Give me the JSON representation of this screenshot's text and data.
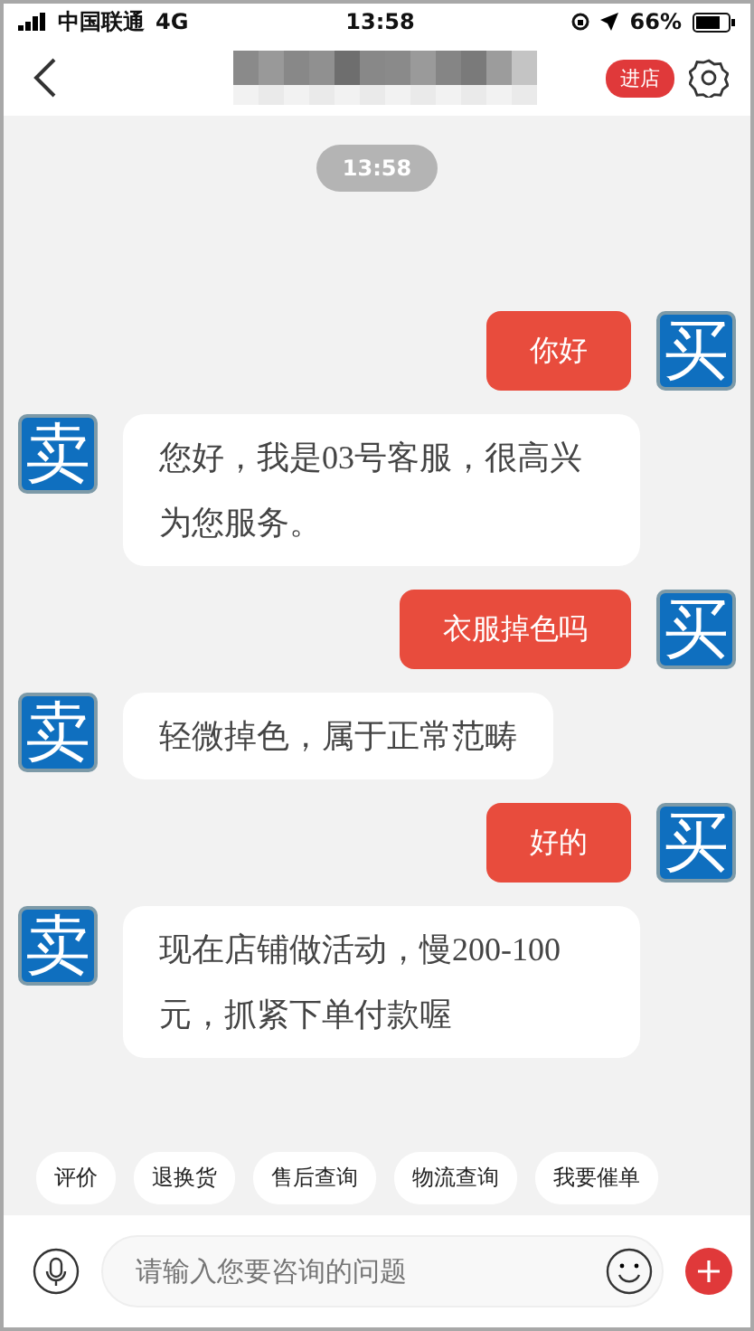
{
  "status_bar": {
    "carrier": "中国联通",
    "network": "4G",
    "time": "13:58",
    "battery": "66%"
  },
  "nav": {
    "store_button": "进店"
  },
  "timestamp": "13:58",
  "messages": [
    {
      "kind": "buyer",
      "avatar": "买",
      "text": "你好"
    },
    {
      "kind": "seller",
      "avatar": "卖",
      "text": "您好，我是03号客服，很高兴为您服务。"
    },
    {
      "kind": "buyer",
      "avatar": "买",
      "text": "衣服掉色吗"
    },
    {
      "kind": "seller",
      "avatar": "卖",
      "text": "轻微掉色，属于正常范畴"
    },
    {
      "kind": "buyer",
      "avatar": "买",
      "text": "好的"
    },
    {
      "kind": "seller",
      "avatar": "卖",
      "text": "现在店铺做活动，慢200-100元，抓紧下单付款喔"
    }
  ],
  "quick_replies": [
    "评价",
    "退换货",
    "售后查询",
    "物流查询",
    "我要催单"
  ],
  "input": {
    "placeholder": "请输入您要咨询的问题"
  }
}
